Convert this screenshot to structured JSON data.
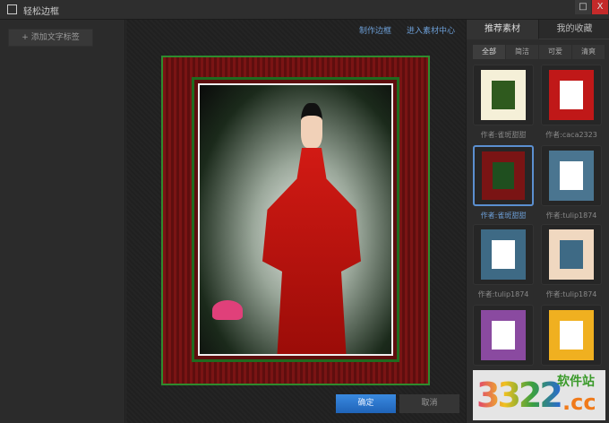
{
  "window": {
    "title": "轻松边框",
    "restore_icon": "□",
    "close_icon": "X"
  },
  "left": {
    "add_label": "添加文字标签",
    "add_icon": "+"
  },
  "canvas": {
    "links": [
      "制作边框",
      "进入素材中心"
    ]
  },
  "right": {
    "tabs": [
      "推荐素材",
      "我的收藏"
    ],
    "filters": [
      "全部",
      "简洁",
      "可爱",
      "清爽"
    ],
    "items": [
      {
        "author": "作者:雀斑甜甜",
        "colors": [
          "#f5f0d8",
          "#2f5a1e"
        ]
      },
      {
        "author": "作者:caca2323",
        "colors": [
          "#c01818",
          "#ffffff"
        ]
      },
      {
        "author": "作者:雀斑甜甜",
        "colors": [
          "#7a1414",
          "#1f4f1f"
        ],
        "selected": true
      },
      {
        "author": "作者:tulip1874",
        "colors": [
          "#4a7590",
          "#ffffff"
        ]
      },
      {
        "author": "作者:tulip1874",
        "colors": [
          "#3e6a85",
          "#ffffff"
        ]
      },
      {
        "author": "作者:tulip1874",
        "colors": [
          "#f0d8c0",
          "#3e6a85"
        ]
      },
      {
        "author": "",
        "colors": [
          "#8a4aa0",
          "#ffffff"
        ]
      },
      {
        "author": "",
        "colors": [
          "#f0b020",
          "#ffffff"
        ]
      }
    ]
  },
  "buttons": {
    "ok": "确定",
    "cancel": "取消"
  },
  "watermark": {
    "number": "3322",
    "site": "软件站",
    "domain": ".cc"
  }
}
